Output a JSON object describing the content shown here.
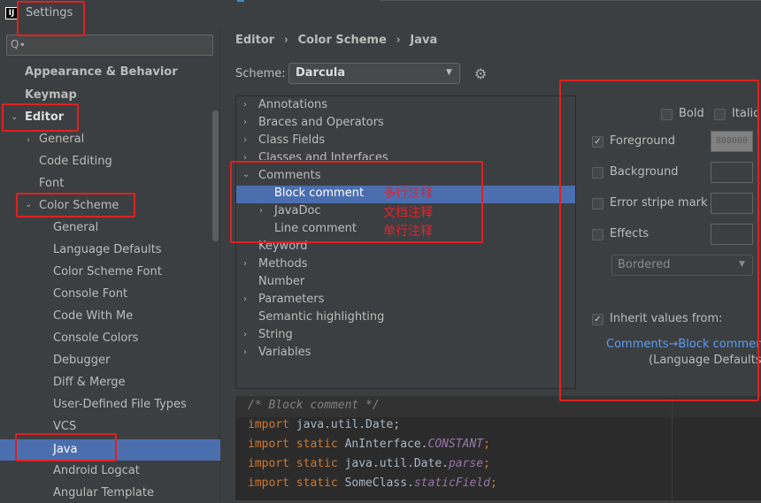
{
  "window": {
    "title": "Settings",
    "app_icon": "IJ"
  },
  "sidebar": {
    "search_placeholder": "Q∙",
    "items": {
      "appearance": "Appearance & Behavior",
      "keymap": "Keymap",
      "editor": "Editor",
      "general": "General",
      "code_editing": "Code Editing",
      "font": "Font",
      "color_scheme": "Color Scheme",
      "cs_general": "General",
      "language_defaults": "Language Defaults",
      "color_scheme_font": "Color Scheme Font",
      "console_font": "Console Font",
      "code_with_me": "Code With Me",
      "console_colors": "Console Colors",
      "debugger": "Debugger",
      "diff_merge": "Diff & Merge",
      "user_defined": "User-Defined File Types",
      "vcs": "VCS",
      "java": "Java",
      "android_logcat": "Android Logcat",
      "angular_template": "Angular Template"
    }
  },
  "breadcrumb": {
    "a": "Editor",
    "sep1": "›",
    "b": "Color Scheme",
    "sep2": "›",
    "c": "Java"
  },
  "scheme": {
    "label": "Scheme:",
    "value": "Darcula"
  },
  "tree": {
    "annotations": "Annotations",
    "braces": "Braces and Operators",
    "class_fields": "Class Fields",
    "classes_interfaces": "Classes and Interfaces",
    "comments": "Comments",
    "block_comment": "Block comment",
    "javadoc": "JavaDoc",
    "line_comment": "Line comment",
    "keyword": "Keyword",
    "methods": "Methods",
    "number": "Number",
    "parameters": "Parameters",
    "semantic": "Semantic highlighting",
    "string": "String",
    "variables": "Variables"
  },
  "notes": {
    "block": "多行注释",
    "javadoc": "文档注释",
    "line": "单行注释"
  },
  "attributes": {
    "bold": "Bold",
    "italic": "Italic",
    "foreground": "Foreground",
    "foreground_value": "808080",
    "background": "Background",
    "error_stripe": "Error stripe mark",
    "effects": "Effects",
    "effects_type": "Bordered",
    "inherit_label": "Inherit values from:",
    "inherit_link": "Comments→Block comment",
    "inherit_source": "(Language Defaults)"
  },
  "preview": {
    "l1": "/* Block comment */",
    "l2_kw": "import",
    "l2_rest": " java.util.Date;",
    "l3_kw": "import static",
    "l3_rest": " AnInterface.",
    "l3_it": "CONSTANT",
    "l3_end": ";",
    "l4_kw": "import static",
    "l4_rest": " java.util.Date.",
    "l4_it": "parse",
    "l4_end": ";",
    "l5_kw": "import static",
    "l5_rest": " SomeClass.",
    "l5_it": "staticField",
    "l5_end": ";"
  },
  "colors": {
    "selection": "#4b6eaf",
    "annotation": "#e02020",
    "link": "#589df6"
  }
}
